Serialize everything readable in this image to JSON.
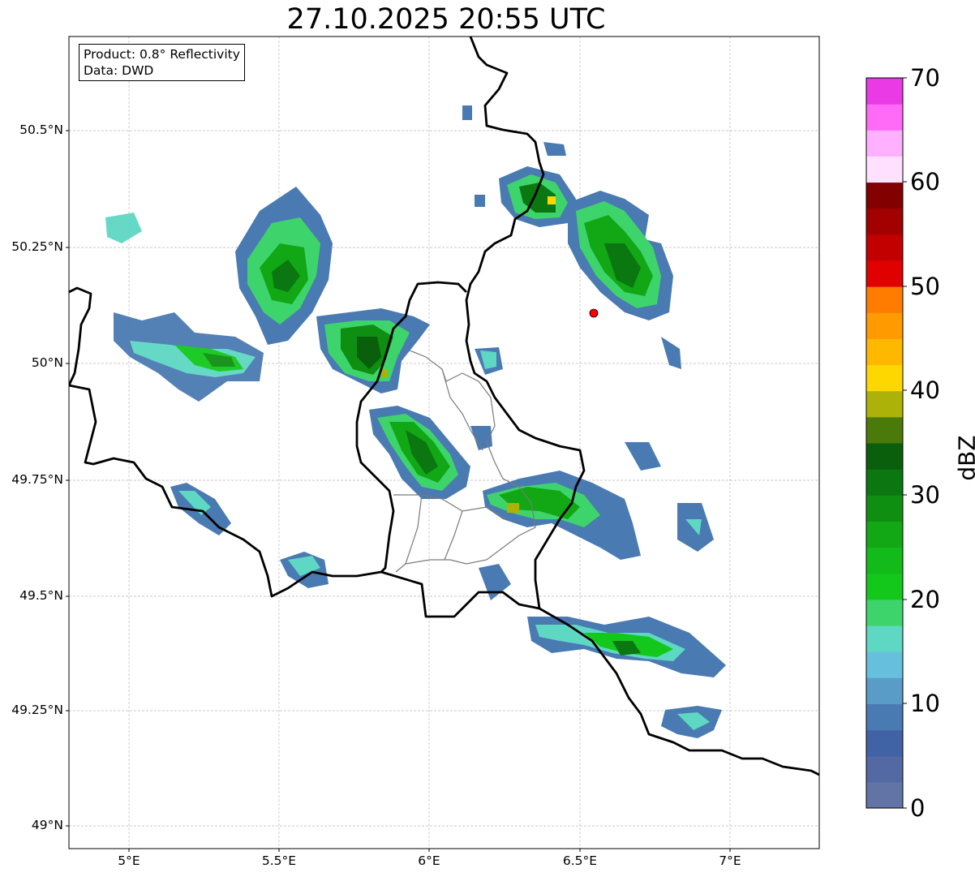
{
  "title": "27.10.2025 20:55 UTC",
  "info": {
    "product": "Product: 0.8° Reflectivity",
    "data": "Data: DWD"
  },
  "map": {
    "lon_range": [
      4.8,
      7.3
    ],
    "lat_range": [
      48.95,
      50.69
    ],
    "grid": true,
    "radar_site": {
      "lon": 6.55,
      "lat": 50.11,
      "color": "#ff0000"
    }
  },
  "axes": {
    "x_ticks": [
      "5°E",
      "5.5°E",
      "6°E",
      "6.5°E",
      "7°E"
    ],
    "y_ticks": [
      "49°N",
      "49.25°N",
      "49.5°N",
      "49.75°N",
      "50°N",
      "50.25°N",
      "50.5°N"
    ]
  },
  "colorbar": {
    "label": "dBZ",
    "min": 0,
    "max": 70,
    "ticks": [
      "0",
      "10",
      "20",
      "30",
      "40",
      "50",
      "60",
      "70"
    ],
    "colors": [
      "#6273a6",
      "#5369a3",
      "#4262a6",
      "#4a7ab2",
      "#599cc8",
      "#66c0dd",
      "#5ed7c3",
      "#3ed46c",
      "#13c81a",
      "#12ba1a",
      "#11a715",
      "#0e8f11",
      "#0b7710",
      "#095f0c",
      "#4a7a0a",
      "#adb208",
      "#ffd700",
      "#ffb800",
      "#ff9a00",
      "#ff7c00",
      "#e00000",
      "#c30000",
      "#a30000",
      "#820000",
      "#ffe0ff",
      "#ffb0ff",
      "#ff6af7",
      "#e93ae6"
    ]
  }
}
